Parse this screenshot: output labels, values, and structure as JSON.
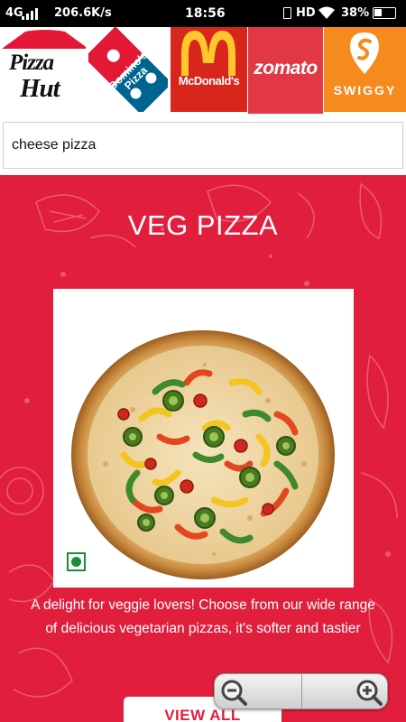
{
  "status_bar": {
    "network": "4G",
    "speed": "206.6K/s",
    "time": "18:56",
    "hd": "HD",
    "battery": "38%",
    "icons": [
      "signal-icon",
      "battery-saver-icon",
      "wifi-icon",
      "battery-icon"
    ]
  },
  "brands": {
    "pizza_hut": {
      "line1": "Pizza",
      "line2": "Hut",
      "color": "#e31837"
    },
    "dominos": {
      "line1": "Domino's",
      "line2": "Pizza",
      "red": "#e31837",
      "blue": "#006491"
    },
    "mcdonalds": {
      "label": "McDonald's",
      "color": "#d7261c",
      "arch_color": "#ffc72c"
    },
    "zomato": {
      "label": "zomato",
      "color": "#e23744"
    },
    "swiggy": {
      "label": "SWIGGY",
      "color": "#f58a1f"
    }
  },
  "search": {
    "value": "cheese pizza"
  },
  "section": {
    "title": "VEG PIZZA",
    "background": "#e21e3d",
    "description": "A delight for veggie lovers! Choose from our wide range of delicious vegetarian pizzas, it's softer and tastier",
    "button_label": "VIEW ALL",
    "veg_mark_color": "#1c8a3a"
  },
  "zoom": {
    "icons": [
      "zoom-out-icon",
      "zoom-in-icon"
    ]
  }
}
